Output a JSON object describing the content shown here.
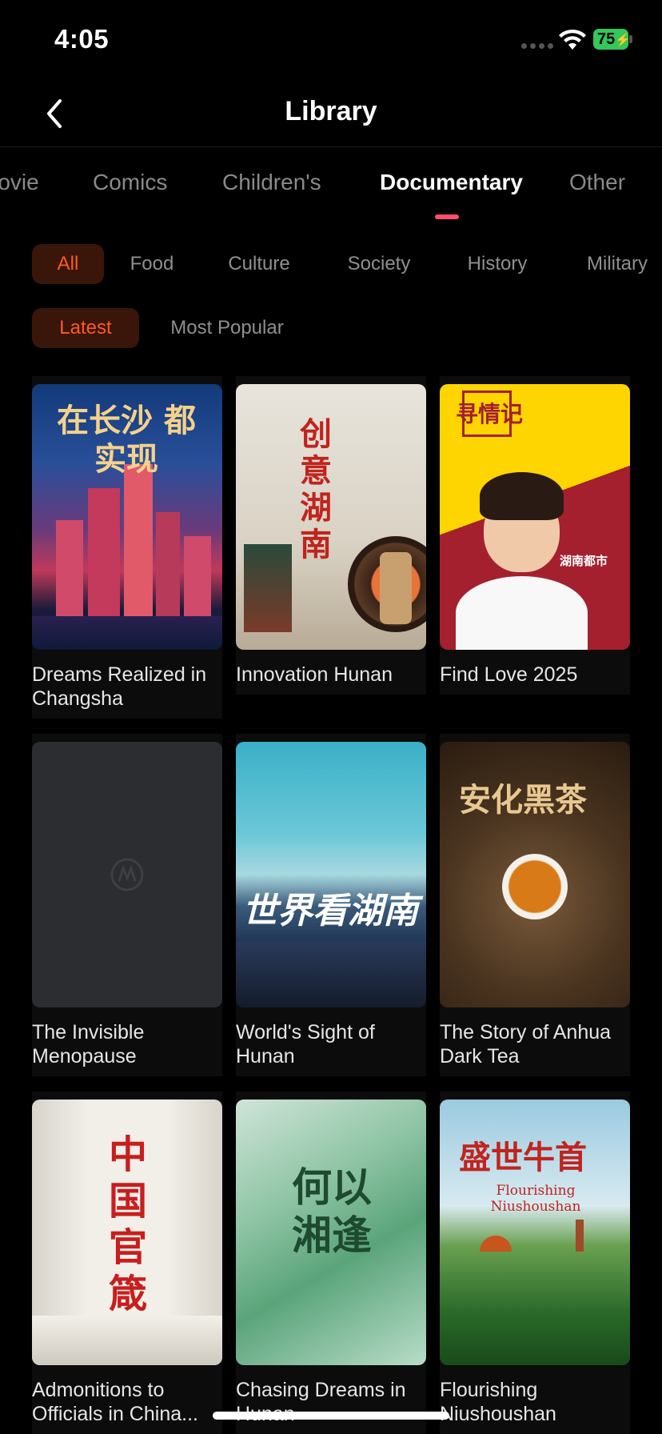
{
  "status_bar": {
    "time": "4:05",
    "battery": "75"
  },
  "header": {
    "title": "Library"
  },
  "category_tabs": [
    {
      "label": "Movie"
    },
    {
      "label": "Comics"
    },
    {
      "label": "Children's"
    },
    {
      "label": "Documentary",
      "active": true
    },
    {
      "label": "Other"
    }
  ],
  "genre_chips": [
    {
      "label": "All",
      "active": true
    },
    {
      "label": "Food"
    },
    {
      "label": "Culture"
    },
    {
      "label": "Society"
    },
    {
      "label": "History"
    },
    {
      "label": "Military"
    }
  ],
  "sort_chips": [
    {
      "label": "Latest",
      "active": true
    },
    {
      "label": "Most Popular"
    }
  ],
  "items": [
    {
      "title": "Dreams Realized in Changsha",
      "poster_text": "在长沙 都实现"
    },
    {
      "title": "Innovation Hunan",
      "poster_text": "创意湖南"
    },
    {
      "title": "Find Love 2025",
      "poster_text": "寻情记",
      "poster_brand": "湖南都市"
    },
    {
      "title": "The Invisible Menopause"
    },
    {
      "title": "World's Sight of Hunan",
      "poster_text": "世界看湖南"
    },
    {
      "title": "The Story of Anhua Dark Tea",
      "poster_text": "安化黑茶"
    },
    {
      "title": "Admonitions to Officials in China...",
      "poster_text": "中国官箴"
    },
    {
      "title": "Chasing Dreams in Hunan",
      "poster_text": "何以湘逢"
    },
    {
      "title": "Flourishing Niushoushan",
      "poster_text": "盛世牛首",
      "poster_subtitle": "Flourishing Niushoushan"
    }
  ],
  "colors": {
    "accent": "#ff5a1f",
    "tab_indicator": "#ff4d6d",
    "battery": "#34c759"
  }
}
